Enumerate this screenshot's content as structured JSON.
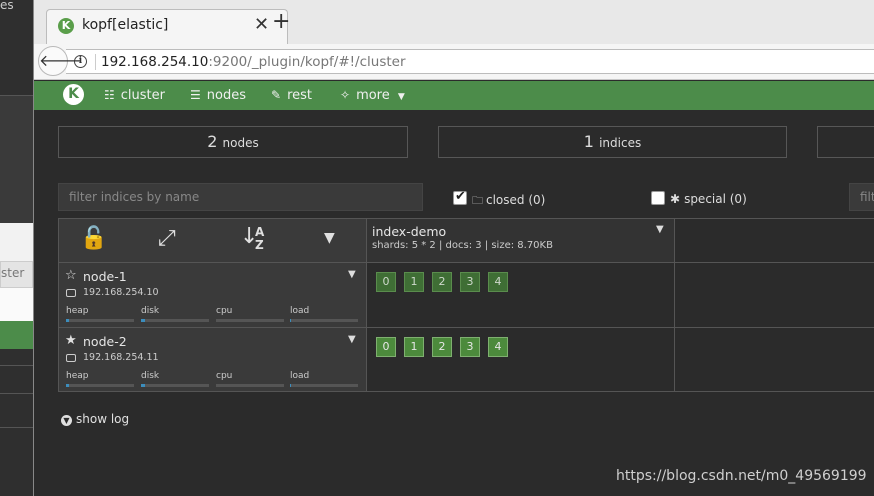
{
  "background_window": {
    "label_top": "es",
    "label_mid": "ster"
  },
  "browser": {
    "tab": {
      "title": "kopf[elastic]",
      "close": "✕",
      "new": "+"
    },
    "address": {
      "host": "192.168.254.10",
      "rest": ":9200/_plugin/kopf/#!/cluster"
    }
  },
  "nav": {
    "logo": "K",
    "items": [
      {
        "label": "cluster",
        "icon": "sitemap-icon"
      },
      {
        "label": "nodes",
        "icon": "list-icon"
      },
      {
        "label": "rest",
        "icon": "edit-icon"
      },
      {
        "label": "more",
        "icon": "magic-wand-icon"
      }
    ]
  },
  "stats": [
    {
      "value": "2",
      "label": "nodes"
    },
    {
      "value": "1",
      "label": "indices"
    }
  ],
  "filters": {
    "indices_placeholder": "filter indices by name",
    "closed_label": "closed (0)",
    "special_label": "special (0)",
    "second_placeholder": "filte"
  },
  "index": {
    "name": "index-demo",
    "meta": "shards: 5 * 2 | docs: 3 | size: 8.70KB"
  },
  "nodes": [
    {
      "name": "node-1",
      "ip": "192.168.254.10",
      "master": false,
      "metrics": [
        {
          "label": "heap",
          "value": 0.04
        },
        {
          "label": "disk",
          "value": 0.06
        },
        {
          "label": "cpu",
          "value": 0
        },
        {
          "label": "load",
          "value": 0.01
        }
      ],
      "shards": [
        "0",
        "1",
        "2",
        "3",
        "4"
      ],
      "shard_kind": "replica"
    },
    {
      "name": "node-2",
      "ip": "192.168.254.11",
      "master": true,
      "metrics": [
        {
          "label": "heap",
          "value": 0.04
        },
        {
          "label": "disk",
          "value": 0.06
        },
        {
          "label": "cpu",
          "value": 0
        },
        {
          "label": "load",
          "value": 0.01
        }
      ],
      "shards": [
        "0",
        "1",
        "2",
        "3",
        "4"
      ],
      "shard_kind": "primary"
    }
  ],
  "show_log": "show log",
  "watermark": "https://blog.csdn.net/m0_49569199",
  "colors": {
    "nav_green": "#4c8c4a",
    "shard_green": "#4c8a3c",
    "bar_blue": "#3c8dbc"
  }
}
